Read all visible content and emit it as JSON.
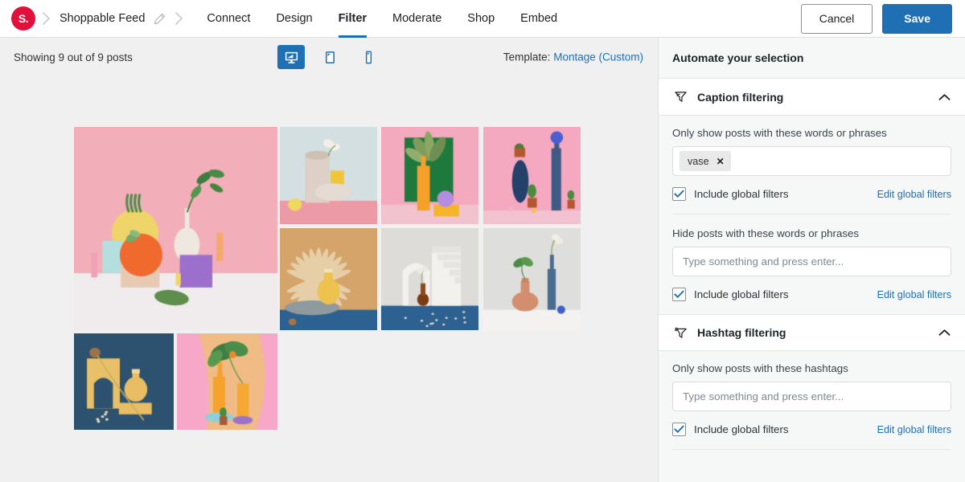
{
  "topbar": {
    "logo_text": "S.",
    "feed_name": "Shoppable Feed",
    "edit_icon": "pencil-icon",
    "tabs": [
      {
        "label": "Connect",
        "active": false
      },
      {
        "label": "Design",
        "active": false
      },
      {
        "label": "Filter",
        "active": true
      },
      {
        "label": "Moderate",
        "active": false
      },
      {
        "label": "Shop",
        "active": false
      },
      {
        "label": "Embed",
        "active": false
      }
    ],
    "cancel_label": "Cancel",
    "save_label": "Save",
    "accent_blue": "#1f6fb5",
    "brand_red": "#e0123c"
  },
  "preview": {
    "showing_text": "Showing 9 out of 9 posts",
    "devices": [
      {
        "name": "desktop-view-button",
        "icon": "desktop-icon",
        "active": true
      },
      {
        "name": "tablet-view-button",
        "icon": "tablet-icon",
        "active": false
      },
      {
        "name": "mobile-view-button",
        "icon": "mobile-icon",
        "active": false
      }
    ],
    "template_label": "Template:",
    "template_value": "Montage (Custom)",
    "posts": [
      {
        "alt": "Pink scene with orange, yellow and white ceramic vases on pedestals"
      },
      {
        "alt": "Beige vase with white flowers and shell on pink surface"
      },
      {
        "alt": "Orange bottle vase with green leaf against green board on pink"
      },
      {
        "alt": "Blue ceramic vases with cacti in terracotta pots on pink"
      },
      {
        "alt": "Yellow round vase with dried palm fan on blue surface"
      },
      {
        "alt": "Brown glass vase beside white arches and stairs on blue"
      },
      {
        "alt": "Terracotta and blue vases with flowering stems on white"
      },
      {
        "alt": "Yellow arch and yellow bottle on dark blue background"
      },
      {
        "alt": "Orange vases with monstera leaf on pink and peach backdrop"
      }
    ]
  },
  "panel": {
    "header_title": "Automate your selection",
    "sections": [
      {
        "title": "Caption filtering",
        "icon": "filter-funnel-icon",
        "caret": "chevron-up-icon",
        "expanded": true,
        "fields": [
          {
            "label": "Only show posts with these words or phrases",
            "type": "tags",
            "tags": [
              "vase"
            ],
            "placeholder": "Type something and press enter...",
            "checkbox_label": "Include global filters",
            "checked": true,
            "edit_link": "Edit global filters"
          },
          {
            "label": "Hide posts with these words or phrases",
            "type": "text",
            "value": "",
            "placeholder": "Type something and press enter...",
            "checkbox_label": "Include global filters",
            "checked": true,
            "edit_link": "Edit global filters"
          }
        ]
      },
      {
        "title": "Hashtag filtering",
        "icon": "filter-hashtag-icon",
        "caret": "chevron-up-icon",
        "expanded": true,
        "fields": [
          {
            "label": "Only show posts with these hashtags",
            "type": "text",
            "value": "",
            "placeholder": "Type something and press enter...",
            "checkbox_label": "Include global filters",
            "checked": true,
            "edit_link": "Edit global filters"
          }
        ]
      }
    ]
  }
}
